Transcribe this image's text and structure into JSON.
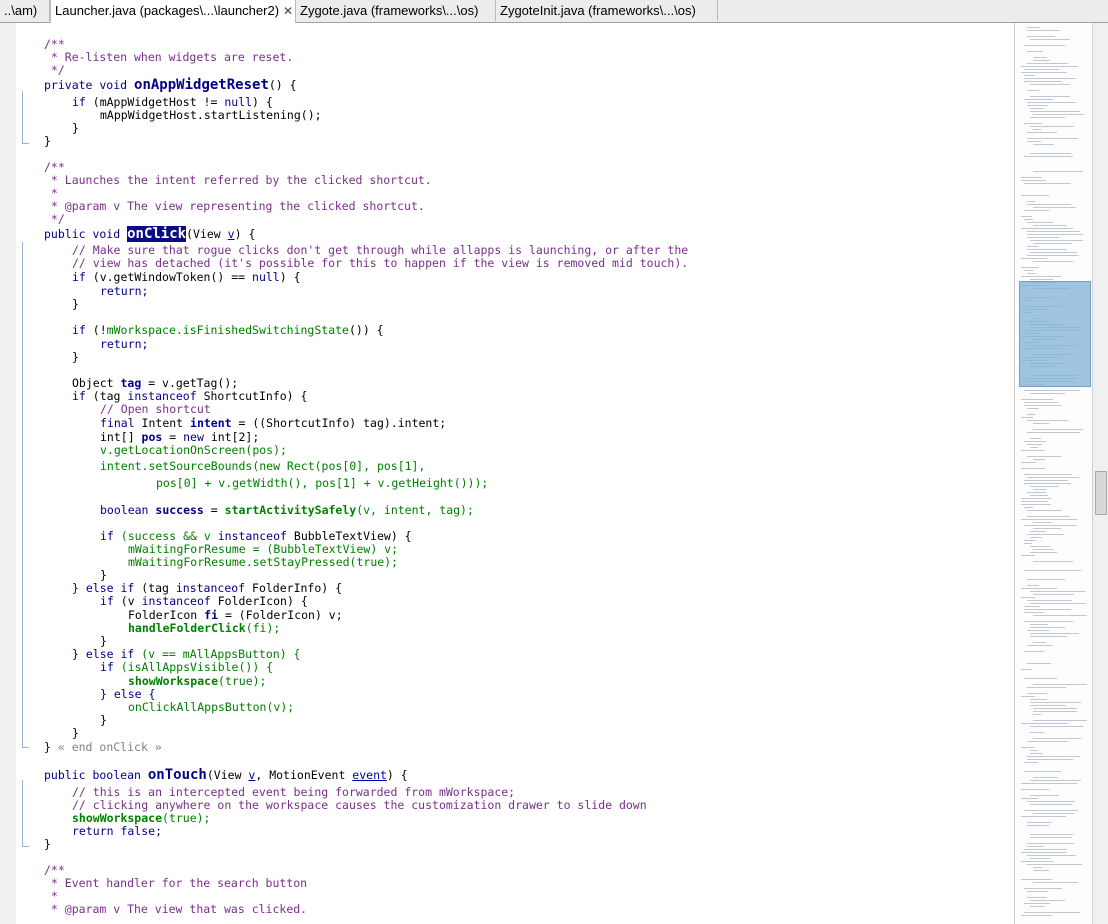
{
  "tabs": [
    {
      "label": "..\\am)"
    },
    {
      "label": "Launcher.java (packages\\...\\launcher2)",
      "close": "✕"
    },
    {
      "label": "Zygote.java (frameworks\\...\\os)"
    },
    {
      "label": "ZygoteInit.java (frameworks\\...\\os)"
    }
  ],
  "code": {
    "l1": "/**",
    "l2": " * Re-listen when widgets are reset.",
    "l3": " */",
    "l4a": "private void ",
    "l4b": "onAppWidgetReset",
    "l4c": "() {",
    "l5a": "if",
    "l5b": " (mAppWidgetHost != ",
    "l5c": "null",
    "l5d": ") {",
    "l6": "mAppWidgetHost.startListening();",
    "l7": "}",
    "l8": "}",
    "l9": "/**",
    "l10": " * Launches the intent referred by the clicked shortcut.",
    "l11": " *",
    "l12": " * @param v The view representing the clicked shortcut.",
    "l13": " */",
    "l14a": "public void ",
    "l14b": "onClick",
    "l14c": "(View ",
    "l14d": "v",
    "l14e": ") {",
    "l15": "// Make sure that rogue clicks don't get through while allapps is launching, or after the",
    "l16": "// view has detached (it's possible for this to happen if the view is removed mid touch).",
    "l17a": "if",
    "l17b": " (v.getWindowToken() == ",
    "l17c": "null",
    "l17d": ") {",
    "l18": "return;",
    "l19": "}",
    "l20a": "if",
    "l20b": " (!",
    "l20c": "mWorkspace.isFinishedSwitchingState",
    "l20d": "()) {",
    "l21": "return;",
    "l22": "}",
    "l23a": "Object ",
    "l23b": "tag",
    "l23c": " = v.getTag();",
    "l24a": "if",
    "l24b": " (tag ",
    "l24c": "instanceof",
    "l24d": " ShortcutInfo) {",
    "l25": "// Open shortcut",
    "l26a": "final",
    "l26b": " Intent ",
    "l26c": "intent",
    "l26d": " = ((ShortcutInfo) tag).intent;",
    "l27a": "int[] ",
    "l27b": "pos",
    "l27c": " = ",
    "l27d": "new",
    "l27e": " int[2];",
    "l28": "v.getLocationOnScreen(pos);",
    "l29": "intent.setSourceBounds(new Rect(pos[0], pos[1],",
    "l30": "pos[0] + v.getWidth(), pos[1] + v.getHeight()));",
    "l31a": "boolean ",
    "l31b": "success",
    "l31c": " = ",
    "l31d": "startActivitySafely",
    "l31e": "(v, intent, tag);",
    "l32a": "if",
    "l32b": " (success && v ",
    "l32c": "instanceof",
    "l32d": " BubbleTextView) {",
    "l33": "mWaitingForResume = (BubbleTextView) v;",
    "l34": "mWaitingForResume.setStayPressed(true);",
    "l35": "}",
    "l36a": "} else if",
    "l36b": " (tag ",
    "l36c": "instanceof",
    "l36d": " FolderInfo) {",
    "l37a": "if",
    "l37b": " (v ",
    "l37c": "instanceof",
    "l37d": " FolderIcon) {",
    "l38a": "FolderIcon ",
    "l38b": "fi",
    "l38c": " = (FolderIcon) v;",
    "l39a": "handleFolderClick",
    "l39b": "(fi);",
    "l40": "}",
    "l41a": "} else if",
    "l41b": " (v == mAllAppsButton) {",
    "l42a": "if",
    "l42b": " (isAllAppsVisible()) {",
    "l43a": "showWorkspace",
    "l43b": "(true);",
    "l44": "} else {",
    "l45": "onClickAllAppsButton(v);",
    "l46": "}",
    "l47": "}",
    "l48a": "}",
    "l48b": " « end onClick »",
    "l49a": "public boolean ",
    "l49b": "onTouch",
    "l49c": "(View ",
    "l49d": "v",
    "l49e": ", MotionEvent ",
    "l49f": "event",
    "l49g": ") {",
    "l50": "// this is an intercepted event being forwarded from mWorkspace;",
    "l51": "// clicking anywhere on the workspace causes the customization drawer to slide down",
    "l52a": "showWorkspace",
    "l52b": "(true);",
    "l53": "return false;",
    "l54": "}",
    "l55": "/**",
    "l56": " * Event handler for the search button",
    "l57": " *",
    "l58": " * @param v The view that was clicked."
  }
}
